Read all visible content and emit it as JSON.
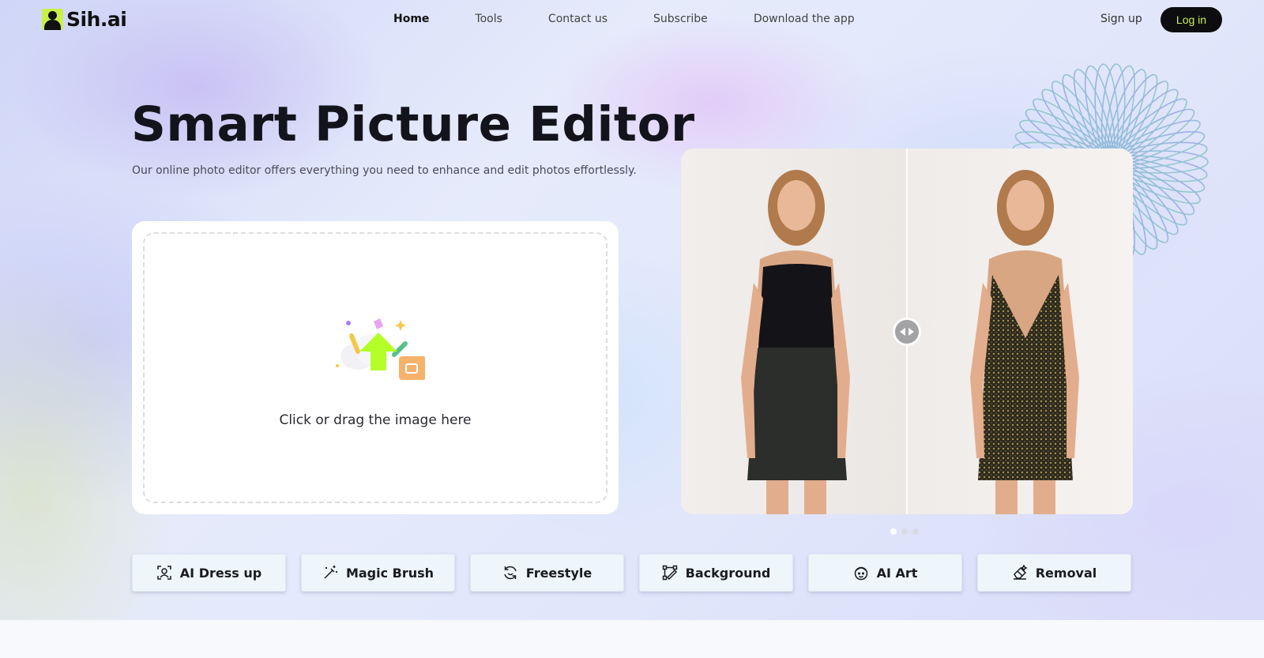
{
  "brand": {
    "name": "Sih.ai"
  },
  "nav": {
    "links": [
      {
        "label": "Home",
        "active": true
      },
      {
        "label": "Tools",
        "active": false
      },
      {
        "label": "Contact us",
        "active": false
      },
      {
        "label": "Subscribe",
        "active": false
      },
      {
        "label": "Download the app",
        "active": false
      }
    ],
    "signup": "Sign up",
    "login": "Log in"
  },
  "hero": {
    "title": "Smart Picture Editor",
    "subtitle": "Our online photo editor offers everything you need to enhance and edit photos effortlessly."
  },
  "upload": {
    "text": "Click or drag the image here"
  },
  "carousel": {
    "active_index": 0,
    "count": 3
  },
  "tools": [
    {
      "label": "AI Dress up",
      "icon": "person-scan-icon"
    },
    {
      "label": "Magic Brush",
      "icon": "magic-wand-icon"
    },
    {
      "label": "Freestyle",
      "icon": "refresh-face-icon"
    },
    {
      "label": "Background",
      "icon": "crop-pen-icon"
    },
    {
      "label": "AI Art",
      "icon": "face-art-icon"
    },
    {
      "label": "Removal",
      "icon": "eraser-icon"
    }
  ],
  "colors": {
    "accent": "#c8f04a",
    "button_dark": "#0d0d10",
    "tool_button_bg": "#eef5fb"
  }
}
